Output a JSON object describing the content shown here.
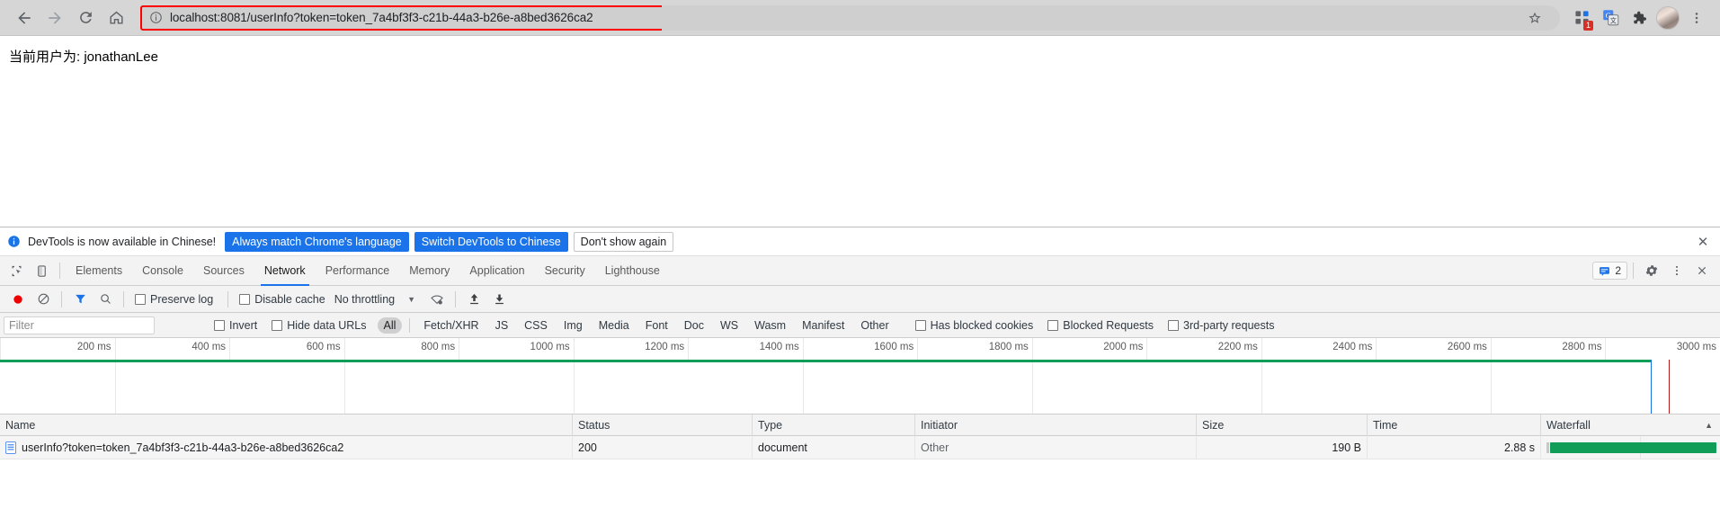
{
  "browser": {
    "nav": {
      "back": "back-arrow",
      "forward": "forward-arrow",
      "reload": "reload",
      "home": "home"
    },
    "omnibox": {
      "security_icon": "info-circle",
      "url": "localhost:8081/userInfo?token=token_7a4bf3f3-c21b-44a3-b26e-a8bed3626ca2",
      "highlight_color": "#ff0000"
    },
    "toolbar_icons": [
      {
        "name": "bookmark-star-icon",
        "badge": ""
      },
      {
        "name": "extensions-grid-icon",
        "badge": "1"
      },
      {
        "name": "google-translate-icon",
        "badge": ""
      },
      {
        "name": "extensions-puzzle-icon",
        "badge": ""
      },
      {
        "name": "profile-avatar",
        "badge": ""
      },
      {
        "name": "chrome-menu-icon",
        "badge": ""
      }
    ]
  },
  "page": {
    "body_text": "当前用户为: jonathanLee"
  },
  "devtools": {
    "banner": {
      "info_icon": "info-icon",
      "message": "DevTools is now available in Chinese!",
      "btn_always": "Always match Chrome's language",
      "btn_switch": "Switch DevTools to Chinese",
      "btn_dismiss": "Don't show again",
      "close": "✕"
    },
    "tabs": [
      {
        "label": "Elements",
        "active": false
      },
      {
        "label": "Console",
        "active": false
      },
      {
        "label": "Sources",
        "active": false
      },
      {
        "label": "Network",
        "active": true
      },
      {
        "label": "Performance",
        "active": false
      },
      {
        "label": "Memory",
        "active": false
      },
      {
        "label": "Application",
        "active": false
      },
      {
        "label": "Security",
        "active": false
      },
      {
        "label": "Lighthouse",
        "active": false
      }
    ],
    "tabbar_right": {
      "message_count": "2",
      "settings_icon": "gear-icon",
      "more_icon": "vertical-dots-icon",
      "close_icon": "close-icon"
    },
    "network_toolbar": {
      "record_icon": "record-icon",
      "clear_icon": "clear-icon",
      "filter_icon": "filter-funnel-icon",
      "search_icon": "search-icon",
      "preserve_log": "Preserve log",
      "disable_cache": "Disable cache",
      "throttle_value": "No throttling",
      "wifi_icon": "network-conditions-icon",
      "import_icon": "import-har-icon",
      "export_icon": "export-har-icon"
    },
    "filter_bar": {
      "placeholder": "Filter",
      "value": "",
      "invert": "Invert",
      "hide_data_urls": "Hide data URLs",
      "types": [
        "All",
        "Fetch/XHR",
        "JS",
        "CSS",
        "Img",
        "Media",
        "Font",
        "Doc",
        "WS",
        "Wasm",
        "Manifest",
        "Other"
      ],
      "active_type": "All",
      "has_blocked_cookies": "Has blocked cookies",
      "blocked_requests": "Blocked Requests",
      "third_party_requests": "3rd-party requests"
    },
    "overview": {
      "ticks": [
        "200 ms",
        "400 ms",
        "600 ms",
        "800 ms",
        "1000 ms",
        "1200 ms",
        "1400 ms",
        "1600 ms",
        "1800 ms",
        "2000 ms",
        "2200 ms",
        "2400 ms",
        "2600 ms",
        "2800 ms",
        "3000 ms"
      ],
      "bar_color": "#0f9d58",
      "bar_end_ms": 2880,
      "total_ms": 3000,
      "dom_content_loaded_color": "#1a73e8",
      "load_color": "#b71c1c",
      "dom_content_loaded_ms": 2880,
      "load_ms": 2910
    },
    "table": {
      "columns": [
        "Name",
        "Status",
        "Type",
        "Initiator",
        "Size",
        "Time",
        "Waterfall"
      ],
      "sort_indicator": "▲",
      "rows": [
        {
          "icon": "document-icon",
          "name": "userInfo?token=token_7a4bf3f3-c21b-44a3-b26e-a8bed3626ca2",
          "status": "200",
          "type": "document",
          "initiator": "Other",
          "size": "190 B",
          "time": "2.88 s",
          "waterfall_color": "#0f9d58"
        }
      ]
    }
  }
}
